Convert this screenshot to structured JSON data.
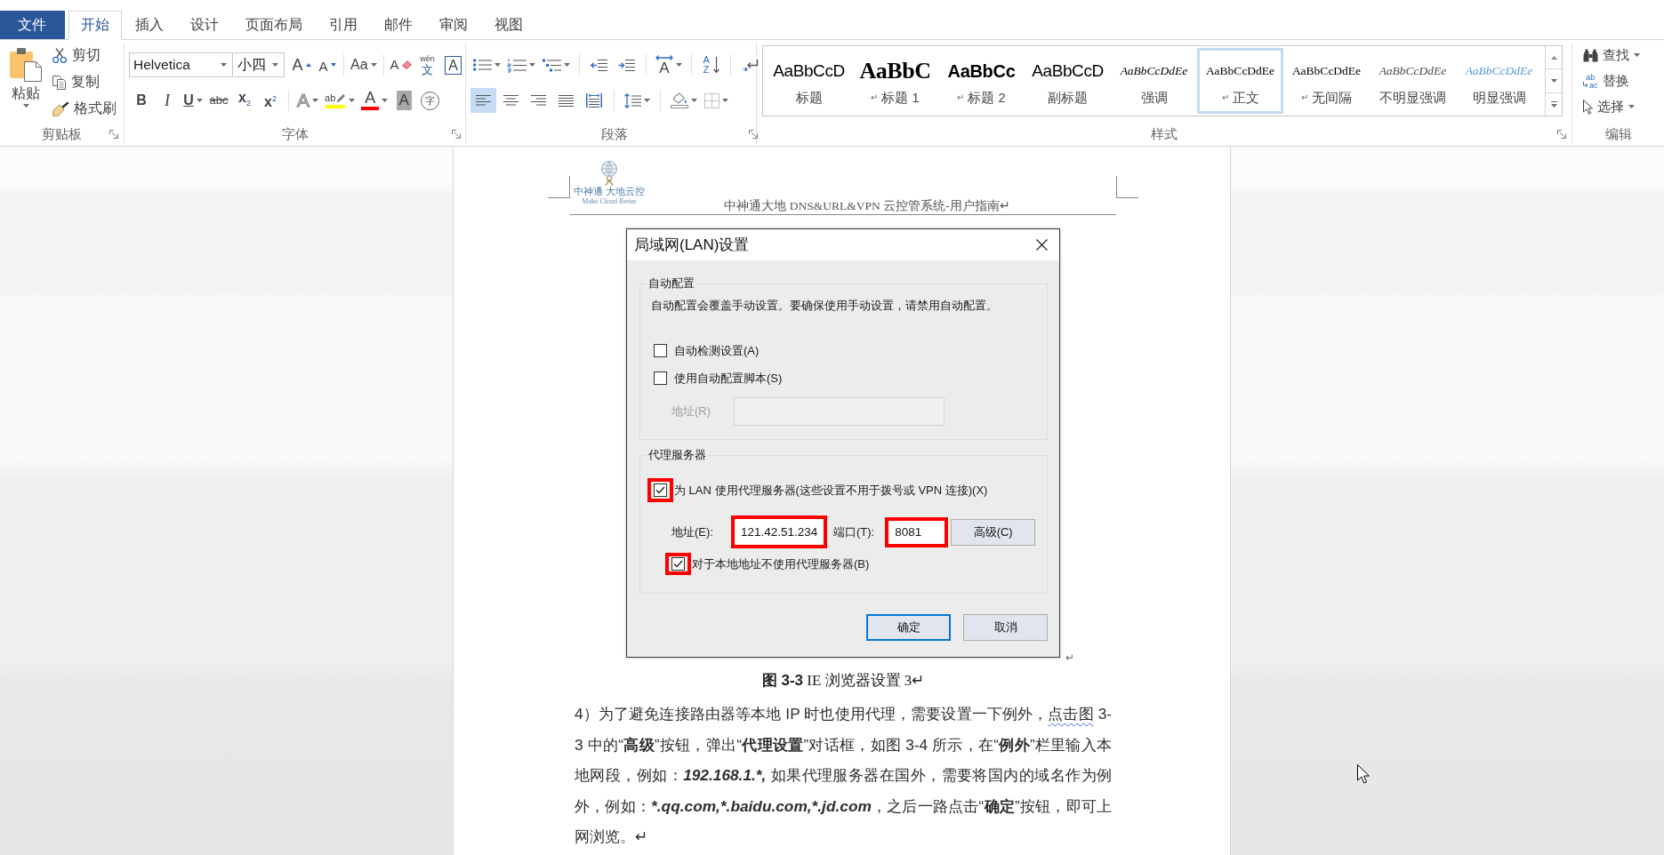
{
  "tabs": [
    {
      "label": "文件",
      "kind": "backstage",
      "selected": false
    },
    {
      "label": "开始",
      "kind": "ribbon",
      "selected": true
    },
    {
      "label": "插入",
      "kind": "ribbon",
      "selected": false
    },
    {
      "label": "设计",
      "kind": "ribbon",
      "selected": false
    },
    {
      "label": "页面布局",
      "kind": "ribbon",
      "selected": false
    },
    {
      "label": "引用",
      "kind": "ribbon",
      "selected": false
    },
    {
      "label": "邮件",
      "kind": "ribbon",
      "selected": false
    },
    {
      "label": "审阅",
      "kind": "ribbon",
      "selected": false
    },
    {
      "label": "视图",
      "kind": "ribbon",
      "selected": false
    }
  ],
  "ribbon": {
    "clipboard": {
      "label": "剪贴板",
      "launcher": true,
      "paste": "粘贴",
      "tools": [
        {
          "kind": "cut",
          "label": "剪切"
        },
        {
          "kind": "copy",
          "label": "复制"
        },
        {
          "kind": "painter",
          "label": "格式刷"
        }
      ]
    },
    "font": {
      "label": "字体",
      "launcher": true,
      "font_name": "Helvetica",
      "font_size": "小四",
      "row1": [
        [
          {
            "kind": "grow",
            "glyph": "A",
            "dropdown": false
          },
          {
            "kind": "shrink",
            "glyph": "A",
            "dropdown": false
          }
        ],
        [
          {
            "kind": "case",
            "glyph": "Aa",
            "dropdown": true
          }
        ],
        [
          {
            "kind": "clear",
            "glyph": "A",
            "dropdown": false
          },
          {
            "kind": "phonetic",
            "glyph": "文",
            "ruby": "wén",
            "dropdown": false
          },
          {
            "kind": "border",
            "glyph": "A",
            "dropdown": false
          }
        ]
      ],
      "row2": [
        [
          {
            "kind": "bold",
            "glyph": "B",
            "dropdown": false
          },
          {
            "kind": "italic",
            "glyph": "I",
            "dropdown": false
          },
          {
            "kind": "underline",
            "glyph": "U",
            "dropdown": true
          },
          {
            "kind": "strike",
            "glyph": "abc",
            "dropdown": false
          },
          {
            "kind": "subscript",
            "glyph": "x$_{2}$",
            "dropdown": false
          },
          {
            "kind": "superscript",
            "glyph": "x$^{2}$",
            "dropdown": false
          }
        ],
        [
          {
            "kind": "effects",
            "glyph": "A",
            "dropdown": true
          },
          {
            "kind": "highlight",
            "glyph": "ab",
            "color": "#ffff00",
            "dropdown": true
          },
          {
            "kind": "color",
            "glyph": "A",
            "color": "#ff0000",
            "dropdown": true
          },
          {
            "kind": "shading",
            "glyph": "A",
            "dropdown": false
          },
          {
            "kind": "enclose",
            "glyph": "字",
            "dropdown": false
          }
        ]
      ]
    },
    "paragraph": {
      "label": "段落",
      "launcher": true,
      "row1": [
        [
          {
            "kind": "bullets",
            "dropdown": true
          },
          {
            "kind": "numbering",
            "dropdown": true
          },
          {
            "kind": "multilevel",
            "dropdown": true
          }
        ],
        [
          {
            "kind": "outdent",
            "dropdown": false
          },
          {
            "kind": "indent",
            "dropdown": false
          }
        ],
        [
          {
            "kind": "asian",
            "glyph": "A",
            "dropdown": true
          }
        ],
        [
          {
            "kind": "sort",
            "glyph": "AZ",
            "dropdown": false
          }
        ],
        [
          {
            "kind": "marks",
            "dropdown": false
          }
        ]
      ],
      "row2": [
        [
          {
            "kind": "left",
            "selected": true,
            "dropdown": false
          },
          {
            "kind": "center",
            "selected": false,
            "dropdown": false
          },
          {
            "kind": "right",
            "selected": false,
            "dropdown": false
          },
          {
            "kind": "justify",
            "selected": false,
            "dropdown": false
          },
          {
            "kind": "distributed",
            "selected": false,
            "dropdown": false
          }
        ],
        [
          {
            "kind": "spacing",
            "dropdown": true
          }
        ],
        [
          {
            "kind": "shading",
            "dropdown": true
          },
          {
            "kind": "borders",
            "dropdown": true
          }
        ]
      ]
    },
    "styles": {
      "label": "样式",
      "launcher": true,
      "items": [
        {
          "kind": "title",
          "preview": "AaBbCcD",
          "name": "标题",
          "selected": false
        },
        {
          "kind": "heading1",
          "preview": "AaBbC",
          "mark": "↵",
          "name": "标题 1",
          "selected": false
        },
        {
          "kind": "heading2",
          "preview": "AaBbCc",
          "mark": "↵",
          "name": "标题 2",
          "selected": false
        },
        {
          "kind": "subtitle",
          "preview": "AaBbCcD",
          "name": "副标题",
          "selected": false
        },
        {
          "kind": "emphasis",
          "preview": "AaBbCcDdEe",
          "name": "强调",
          "selected": false
        },
        {
          "kind": "normal",
          "preview": "AaBbCcDdEe",
          "mark": "↵",
          "name": "正文",
          "selected": true
        },
        {
          "kind": "nospacing",
          "preview": "AaBbCcDdEe",
          "mark": "↵",
          "name": "无间隔",
          "selected": false
        },
        {
          "kind": "subtle",
          "preview": "AaBbCcDdEe",
          "name": "不明显强调",
          "selected": false
        },
        {
          "kind": "intense",
          "preview": "AaBbCcDdEe",
          "name": "明显强调",
          "selected": false
        }
      ]
    },
    "editing": {
      "label": "编辑",
      "launcher": false,
      "tools": [
        {
          "kind": "find",
          "label": "查找",
          "dropdown": true
        },
        {
          "kind": "replace",
          "glyph": "ab",
          "glyph_target": "ac",
          "label": "替换",
          "dropdown": false
        },
        {
          "kind": "select",
          "label": "选择",
          "dropdown": true
        }
      ]
    }
  },
  "document": {
    "header": {
      "logo_name": "中神通 大地云控",
      "logo_tagline": "Make Cloud Better",
      "text": "中神通大地 DNS&URL&VPN 云控管系统-用户指南↵"
    },
    "figure": {
      "mark": "↵",
      "dialog": {
        "title": "局域网(LAN)设置",
        "auto_config": {
          "legend": "自动配置",
          "note": "自动配置会覆盖手动设置。要确保使用手动设置，请禁用自动配置。",
          "options": [
            {
              "label": "自动检测设置(A)",
              "checked": false,
              "highlighted": false
            },
            {
              "label": "使用自动配置脚本(S)",
              "checked": false,
              "highlighted": false
            }
          ],
          "address": {
            "label": "地址(R)",
            "disabled": true
          }
        },
        "proxy": {
          "legend": "代理服务器",
          "options": [
            {
              "label": "为 LAN 使用代理服务器(这些设置不用于拨号或 VPN 连接)(X)",
              "checked": true,
              "highlighted": true
            }
          ],
          "address": {
            "label": "地址(E):",
            "value": "121.42.51.234",
            "highlighted": true
          },
          "port": {
            "label": "端口(T):",
            "value": "8081",
            "highlighted": true
          },
          "advanced": "高级(C)",
          "bypass": {
            "label": "对于本地地址不使用代理服务器(B)",
            "checked": true,
            "highlighted": true
          }
        },
        "buttons": [
          {
            "label": "确定",
            "default": true
          },
          {
            "label": "取消",
            "default": false
          }
        ]
      }
    },
    "caption": "**图 3-3** IE 浏览器设置 3↵",
    "paragraph": [
      {
        "text": "4）为了避免连接路由器等本地 IP 时也使用代理，需要设置一下例外，",
        "kind": "plain"
      },
      {
        "text": "点击图",
        "kind": "wavy"
      },
      {
        "text": " 3-3 中的“",
        "kind": "plain"
      },
      {
        "text": "高级",
        "kind": "bold"
      },
      {
        "text": "”按钮，弹出“",
        "kind": "plain"
      },
      {
        "text": "代理设置",
        "kind": "bold"
      },
      {
        "text": "”对话框，如图 3-4 所示，在“",
        "kind": "plain"
      },
      {
        "text": "例外",
        "kind": "bold"
      },
      {
        "text": "”栏里输入本地网段，例如：",
        "kind": "plain"
      },
      {
        "text": "192.168.1.*,",
        "kind": "bold-italic"
      },
      {
        "text": " 如果代理服务器在国外，需要将国内的域名作为例外，例如：",
        "kind": "plain"
      },
      {
        "text": "*.qq.com,*.baidu.com,*.jd.com",
        "kind": "bold-italic"
      },
      {
        "text": "，之后一路点击“",
        "kind": "plain"
      },
      {
        "text": "确定",
        "kind": "bold"
      },
      {
        "text": "”按钮，即可上网浏览。↵",
        "kind": "plain"
      }
    ]
  }
}
